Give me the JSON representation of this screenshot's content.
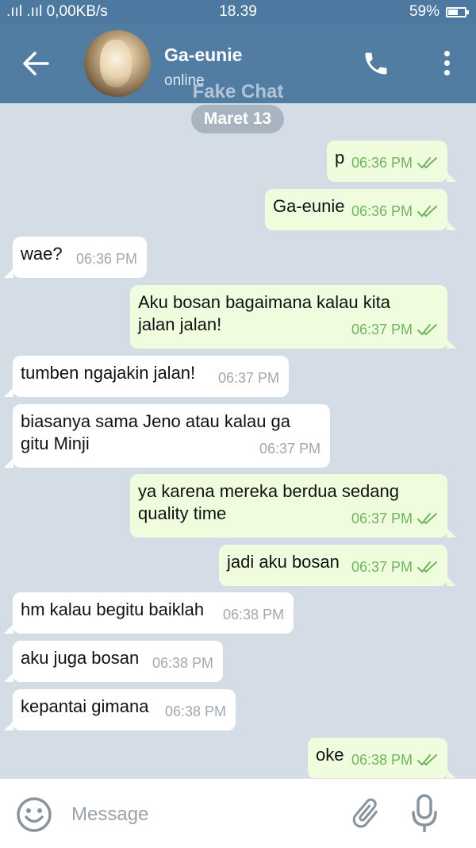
{
  "status_bar": {
    "signal_text": ".ııl .ııl 0,00KB/s",
    "time": "18.39",
    "battery": "59%",
    "battery_level": 0.59
  },
  "header": {
    "contact_name": "Ga-eunie",
    "contact_status": "online",
    "watermark": "Fake Chat"
  },
  "date_chip": "Maret 13",
  "messages": [
    {
      "direction": "out",
      "text": "p",
      "time": "06:36 PM"
    },
    {
      "direction": "out",
      "text": "Ga-eunie",
      "time": "06:36 PM"
    },
    {
      "direction": "in",
      "text": "wae?",
      "time": "06:36 PM"
    },
    {
      "direction": "out",
      "text": "Aku bosan bagaimana kalau kita\njalan jalan!",
      "time": "06:37 PM"
    },
    {
      "direction": "in",
      "text": "tumben ngajakin jalan!",
      "time": "06:37 PM"
    },
    {
      "direction": "in",
      "text": "biasanya sama Jeno atau kalau ga\ngitu Minji",
      "time": "06:37 PM"
    },
    {
      "direction": "out",
      "text": "ya karena mereka berdua sedang\nquality time",
      "time": "06:37 PM"
    },
    {
      "direction": "out",
      "text": "jadi aku bosan",
      "time": "06:37 PM"
    },
    {
      "direction": "in",
      "text": "hm kalau begitu baiklah",
      "time": "06:38 PM"
    },
    {
      "direction": "in",
      "text": "aku juga bosan",
      "time": "06:38 PM"
    },
    {
      "direction": "in",
      "text": "kepantai gimana",
      "time": "06:38 PM"
    },
    {
      "direction": "out",
      "text": "oke",
      "time": "06:38 PM"
    }
  ],
  "input": {
    "placeholder": "Message",
    "value": ""
  },
  "icons": {
    "back": "arrow-left-icon",
    "call": "phone-icon",
    "menu": "more-vertical-icon",
    "emoji": "smiley-icon",
    "attach": "paperclip-icon",
    "mic": "microphone-icon"
  },
  "colors": {
    "header": "#527da3",
    "outgoing_bubble": "#effdde",
    "incoming_bubble": "#ffffff",
    "background": "#d4dde6",
    "read_ticks": "#6fb45d"
  }
}
